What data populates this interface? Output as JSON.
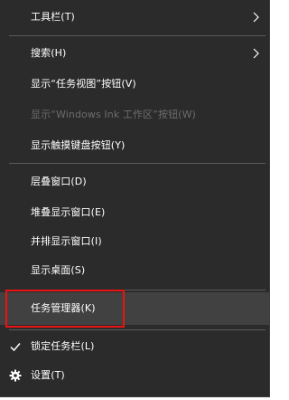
{
  "menu": {
    "items": {
      "toolbar": "工具栏(T)",
      "search": "搜索(H)",
      "task_view": "显示“任务视图”按钮(V)",
      "windows_ink": "显示“Windows Ink 工作区”按钮(W)",
      "touch_keyboard": "显示触摸键盘按钮(Y)",
      "cascade": "层叠窗口(D)",
      "stacked": "堆叠显示窗口(E)",
      "side_by_side": "并排显示窗口(I)",
      "show_desktop": "显示桌面(S)",
      "task_manager": "任务管理器(K)",
      "lock_taskbar": "锁定任务栏(L)",
      "settings": "设置(T)"
    },
    "icons": {
      "submenu_arrow": "chevron-right-icon",
      "checked": "checkmark-icon",
      "settings": "gear-icon"
    },
    "colors": {
      "background": "#2b2b2b",
      "hover": "#414141",
      "text": "#ffffff",
      "disabled_text": "#6d6d6d",
      "separator": "#5a5a5a",
      "highlight_box": "#e81414"
    }
  }
}
